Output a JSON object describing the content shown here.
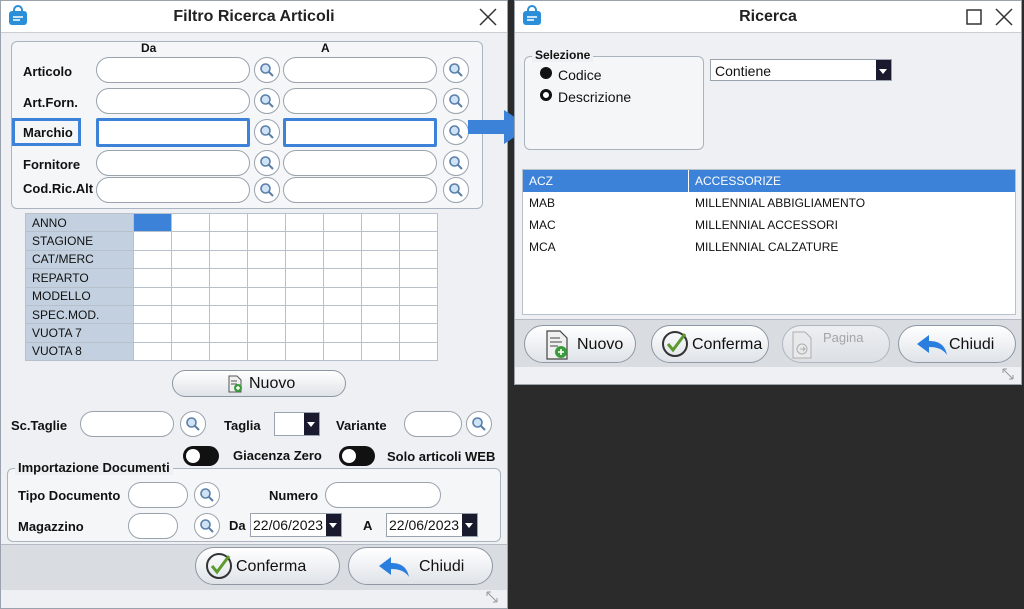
{
  "left_window": {
    "title": "Filtro Ricerca Articoli",
    "col_da": "Da",
    "col_a": "A",
    "rows": [
      {
        "label": "Articolo"
      },
      {
        "label": "Art.Forn."
      },
      {
        "label": "Marchio"
      },
      {
        "label": "Fornitore"
      },
      {
        "label": "Cod.Ric.Alt"
      }
    ],
    "grid_rows": [
      "ANNO",
      "STAGIONE",
      "CAT/MERC",
      "REPARTO",
      "MODELLO",
      "SPEC.MOD.",
      "VUOTA 7",
      "VUOTA 8"
    ],
    "nuovo_label": "Nuovo",
    "sc_taglie_label": "Sc.Taglie",
    "taglia_label": "Taglia",
    "variante_label": "Variante",
    "giacenza_zero_label": "Giacenza Zero",
    "solo_web_label": "Solo articoli WEB",
    "import_legend": "Importazione Documenti",
    "tipo_documento_label": "Tipo Documento",
    "numero_label": "Numero",
    "magazzino_label": "Magazzino",
    "da_label": "Da",
    "a_label": "A",
    "date_from": "22/06/2023",
    "date_to": "22/06/2023",
    "conferma_label": "Conferma",
    "chiudi_label": "Chiudi"
  },
  "right_window": {
    "title": "Ricerca",
    "selezione_legend": "Selezione",
    "radio_codice": "Codice",
    "radio_descrizione": "Descrizione",
    "match_mode": "Contiene",
    "results": [
      {
        "code": "ACZ",
        "desc": "ACCESSORIZE"
      },
      {
        "code": "MAB",
        "desc": "MILLENNIAL ABBIGLIAMENTO"
      },
      {
        "code": "MAC",
        "desc": "MILLENNIAL ACCESSORI"
      },
      {
        "code": "MCA",
        "desc": "MILLENNIAL CALZATURE"
      }
    ],
    "nuovo_label": "Nuovo",
    "conferma_label": "Conferma",
    "pagina_label": "Pagina",
    "chiudi_label": "Chiudi"
  },
  "colors": {
    "accent": "#3b82d8",
    "header": "#c3d0df",
    "dark": "#1a1a2e"
  }
}
